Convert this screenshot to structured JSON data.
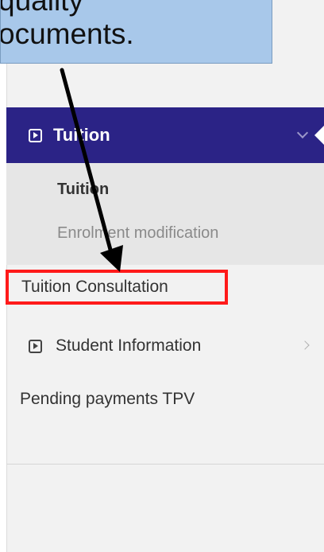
{
  "callout": {
    "line1": "quality",
    "line2": "ocuments."
  },
  "menu": {
    "tuition_header": "Tuition",
    "submenu": {
      "tuition": "Tuition",
      "enrolment": "Enrolment modification"
    },
    "tuition_consultation": "Tuition Consultation",
    "student_information": "Student Information",
    "pending_payments": "Pending payments TPV"
  },
  "colors": {
    "header_bg": "#2b2386",
    "highlight_border": "#ff1a1a",
    "callout_bg": "#a8c8ea"
  },
  "icons": [
    "play-box-icon",
    "chevron-down-icon",
    "chevron-right-icon",
    "arrow-annotation"
  ]
}
